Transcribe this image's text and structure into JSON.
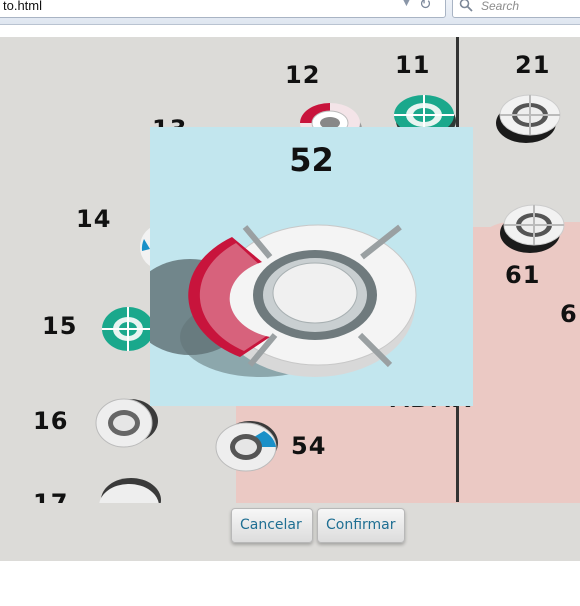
{
  "browser": {
    "url_text": "to.html",
    "search_placeholder": "Search"
  },
  "seats": [
    {
      "number": "11",
      "style": "teal"
    },
    {
      "number": "12",
      "style": "red"
    },
    {
      "number": "13",
      "style": "white"
    },
    {
      "number": "14",
      "style": "blue"
    },
    {
      "number": "15",
      "style": "teal"
    },
    {
      "number": "16",
      "style": "white"
    },
    {
      "number": "17",
      "style": "white"
    },
    {
      "number": "21",
      "style": "white"
    },
    {
      "number": "54",
      "style": "blue"
    },
    {
      "number": "61",
      "style": "white"
    },
    {
      "number": "6",
      "style": "white"
    }
  ],
  "zone": {
    "label": "ADAR"
  },
  "popup": {
    "seat_number": "52",
    "style": "red"
  },
  "buttons": {
    "cancel": "Cancelar",
    "confirm": "Confirmar"
  },
  "colors": {
    "popup_bg": "#c2e6ee",
    "zone_bg": "#ebc9c4",
    "map_bg": "#dcdbd8",
    "teal": "#1aa88c",
    "red": "#c8143c",
    "blue": "#1a90c8",
    "button_text": "#1f6f93"
  }
}
